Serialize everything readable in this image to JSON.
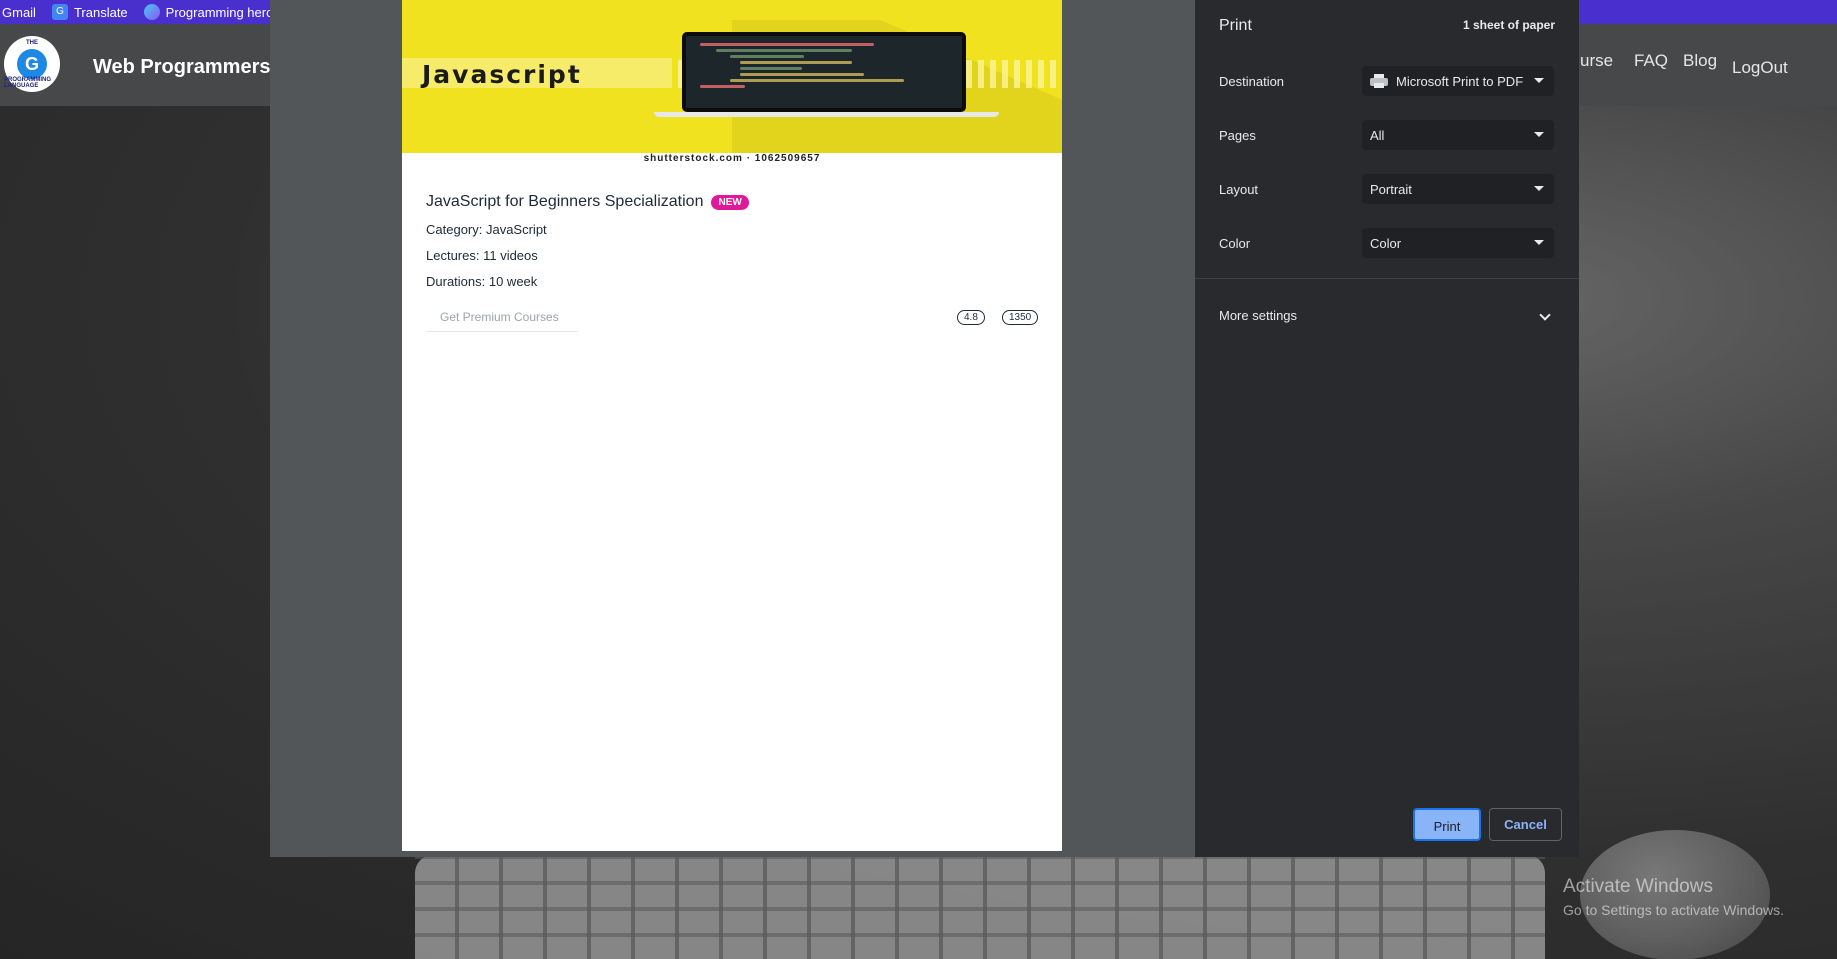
{
  "bookmarks": {
    "items": [
      {
        "label": "Gmail"
      },
      {
        "label": "Translate"
      },
      {
        "label": "Programming hero"
      }
    ]
  },
  "site": {
    "logo_text_top": "THE",
    "logo_letter": "G",
    "logo_text_bottom": "PROGRAMMING LANGUAGE",
    "brand": "Web Programmers",
    "nav": {
      "course": "urse",
      "faq": "FAQ",
      "blog": "Blog",
      "logout": "LogOut"
    }
  },
  "preview": {
    "banner_title": "Javascript",
    "watermark": "shutterstock.com · 1062509657",
    "course_title": "JavaScript for Beginners Specialization",
    "badge": "NEW",
    "category": "Category: JavaScript",
    "lectures": "Lectures: 11 videos",
    "durations": "Durations: 10 week",
    "premium_button": "Get Premium Courses",
    "rating": "4.8",
    "reviews": "1350"
  },
  "print_panel": {
    "title": "Print",
    "sheets": "1 sheet of paper",
    "destination_label": "Destination",
    "destination_value": "Microsoft Print to PDF",
    "pages_label": "Pages",
    "pages_value": "All",
    "layout_label": "Layout",
    "layout_value": "Portrait",
    "color_label": "Color",
    "color_value": "Color",
    "more_settings": "More settings",
    "print_button": "Print",
    "cancel_button": "Cancel"
  },
  "windows_activation": {
    "title": "Activate Windows",
    "subtitle": "Go to Settings to activate Windows."
  },
  "colors": {
    "bookmarks_bar": "#4a2fcf",
    "print_panel_bg": "#292a2d",
    "print_button_bg": "#8ab4f8",
    "new_badge": "#e0189a",
    "banner_yellow": "#f0e21e"
  }
}
